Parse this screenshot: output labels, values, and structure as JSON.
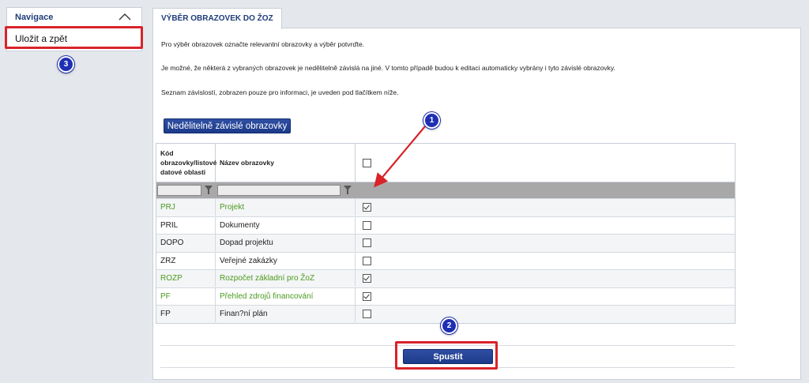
{
  "navigation": {
    "title": "Navigace",
    "toggle_icon": "chevron-up-icon",
    "item_label": "Uložit a zpět"
  },
  "tab": {
    "label": "VÝBĚR OBRAZOVEK DO ŽOZ"
  },
  "info": {
    "line1": "Pro výběr obrazovek označte relevantní obrazovky a výběr potvrďte.",
    "line2": "Je možné, že některá z vybraných obrazovek je nedělitelně závislá na jiné. V tomto případě budou k editaci automaticky vybrány i tyto závislé obrazovky.",
    "line3": "Seznam závislostí, zobrazen pouze pro informaci, je uveden pod tlačítkem níže."
  },
  "dependency_button": "Nedělitelně závislé obrazovky",
  "table": {
    "headers": {
      "code": "Kód obrazovky/listové datové oblasti",
      "name": "Název obrazovky"
    },
    "rows": [
      {
        "code": "PRJ",
        "name": "Projekt",
        "checked": true
      },
      {
        "code": "PRIL",
        "name": "Dokumenty",
        "checked": false
      },
      {
        "code": "DOPO",
        "name": "Dopad projektu",
        "checked": false
      },
      {
        "code": "ZRZ",
        "name": "Veřejné zakázky",
        "checked": false
      },
      {
        "code": "ROZP",
        "name": "Rozpočet základní pro ŽoZ",
        "checked": true
      },
      {
        "code": "PF",
        "name": "Přehled zdrojů financování",
        "checked": true
      },
      {
        "code": "FP",
        "name": "Finan?ní plán",
        "checked": false
      }
    ]
  },
  "run_button": "Spustit",
  "annotations": {
    "badge1": "1",
    "badge2": "2",
    "badge3": "3"
  },
  "colors": {
    "highlight": "#d8232a",
    "badge": "#1f2fb3",
    "selected_text": "#4a9a1e",
    "primary_button": "#1c3a8a"
  }
}
